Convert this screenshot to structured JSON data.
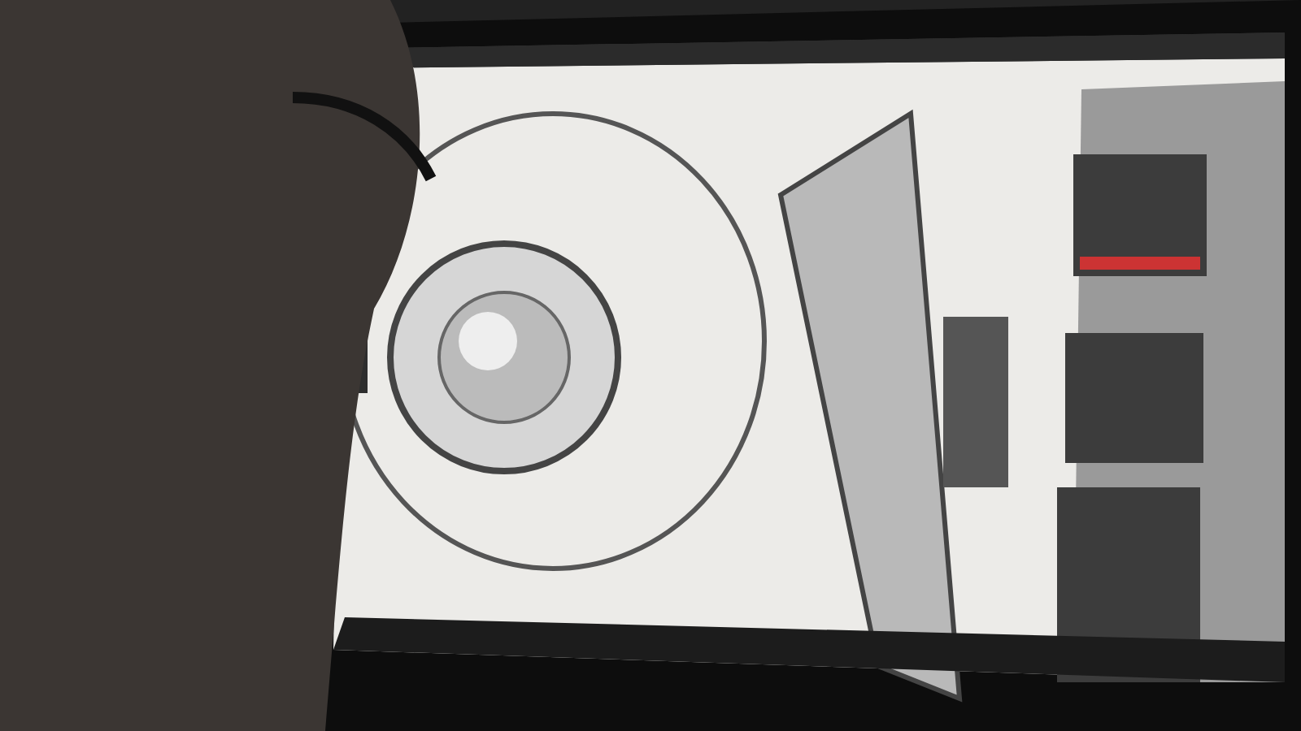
{
  "photo": {
    "kind": "monitor-scene"
  }
}
